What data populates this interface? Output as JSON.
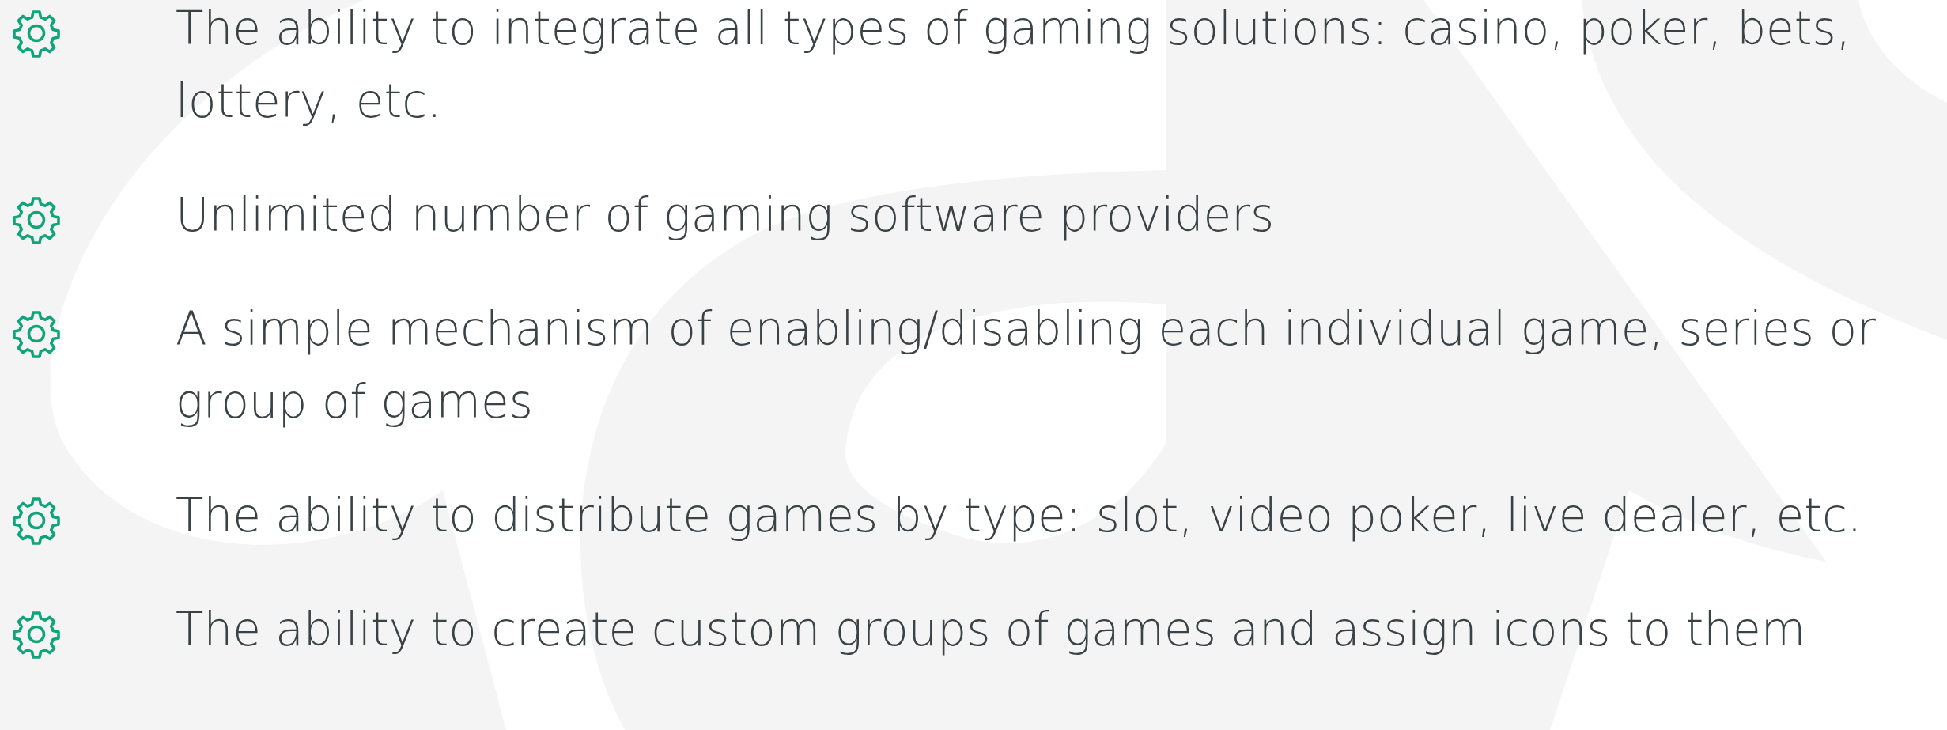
{
  "features": [
    {
      "text": "The ability to integrate all types of gaming solutions: casino, poker, bets, lottery, etc."
    },
    {
      "text": "Unlimited number of gaming software providers"
    },
    {
      "text": "A simple mechanism of enabling/disabling each individual game, series or group of games"
    },
    {
      "text": "The ability to distribute games by type: slot, video poker, live dealer, etc."
    },
    {
      "text": "The ability to create custom groups of games and assign icons to them"
    }
  ]
}
